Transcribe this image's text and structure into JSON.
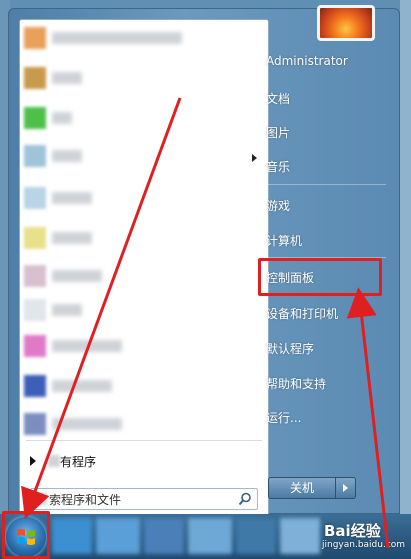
{
  "start_menu": {
    "all_programs_label": "所有程序",
    "all_programs_visible": "有程序",
    "search": {
      "value": "索程序和文件",
      "placeholder": "搜索程序和文件"
    },
    "right_pane": {
      "items": [
        {
          "label": "Administrator"
        },
        {
          "label": "文档"
        },
        {
          "label": "图片"
        },
        {
          "label": "音乐"
        },
        {
          "label": "游戏"
        },
        {
          "label": "计算机"
        },
        {
          "label": "控制面板"
        },
        {
          "label": "设备和打印机"
        },
        {
          "label": "默认程序"
        },
        {
          "label": "帮助和支持"
        },
        {
          "label": "运行..."
        }
      ]
    },
    "shutdown_label": "关机"
  },
  "watermark": {
    "brand": "Bai经验",
    "url": "jingyan.baidu.com"
  },
  "colors": {
    "highlight": "#e02020",
    "menu_blue": "#5b8ab2"
  },
  "icons": [
    "search-icon",
    "windows-logo-icon",
    "arrow-right-icon",
    "user-avatar-icon"
  ]
}
